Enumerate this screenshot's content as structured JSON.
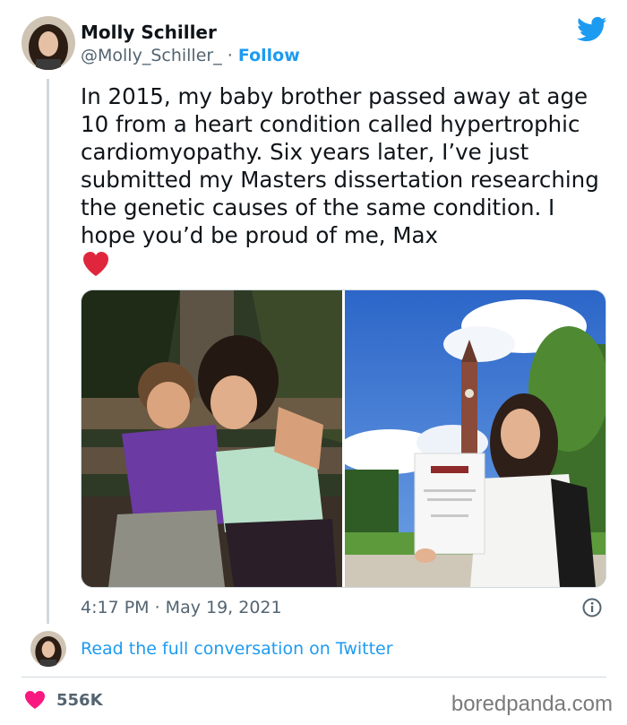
{
  "tweet": {
    "author_name": "Molly Schiller",
    "handle": "@Molly_Schiller_",
    "separator": "·",
    "follow_label": "Follow",
    "text": "In 2015, my baby brother passed away at age 10 from a heart condition called hypertrophic cardiomyopathy. Six years later, I’ve just submitted my Masters dissertation researching the genetic causes of the same condition. I hope you’d be proud of me, Max",
    "emoji": "red-heart",
    "timestamp": "4:17 PM · May 19, 2021",
    "read_full_label": "Read the full conversation on Twitter",
    "like_count": "556K"
  },
  "icons": {
    "brand": "twitter-bird-icon",
    "info": "info-icon",
    "like": "heart-icon"
  },
  "colors": {
    "accent": "#1d9bf0",
    "heart": "#f91880",
    "muted_text": "#536471"
  },
  "watermark": "boredpanda.com"
}
